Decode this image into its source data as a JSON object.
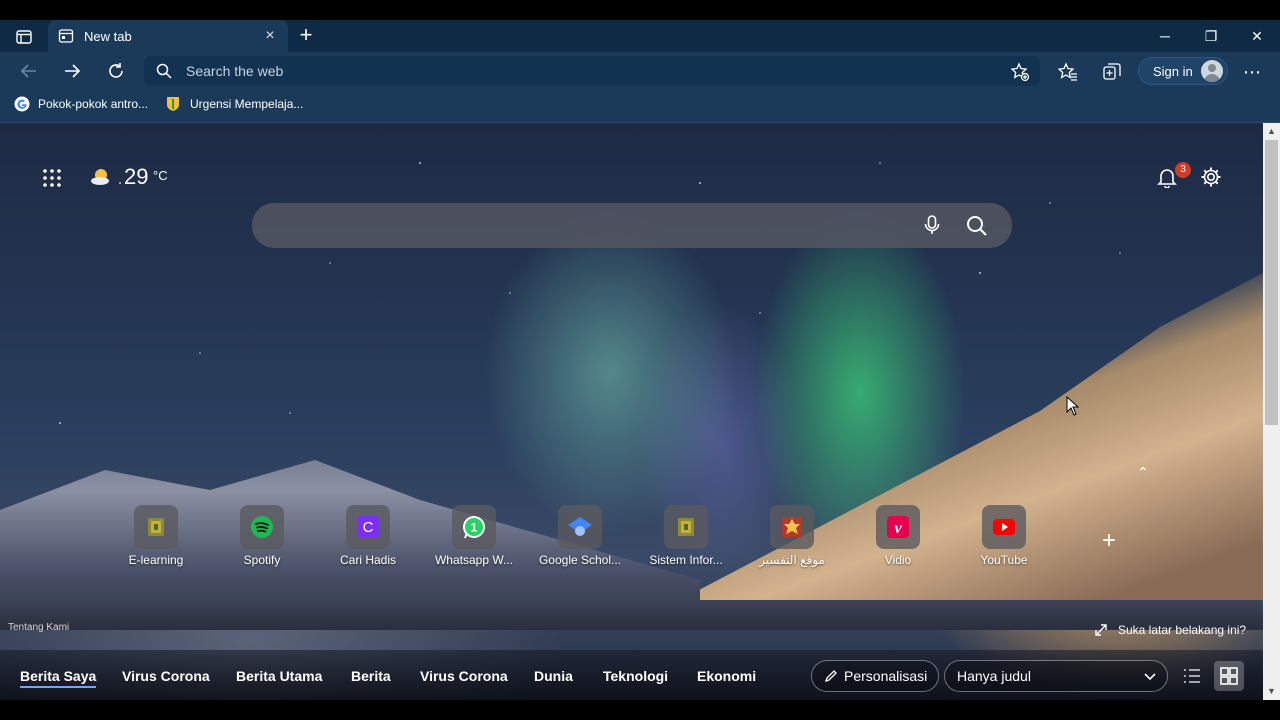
{
  "browser": {
    "tab": {
      "title": "New tab",
      "close": "×"
    },
    "new_tab": "+",
    "window_controls": {
      "minimize": "─",
      "restore": "❐",
      "close": "✕"
    },
    "omnibox": {
      "placeholder": "Search the web"
    },
    "signin": "Sign in",
    "menu": "⋯",
    "bookmarks": [
      {
        "label": "Pokok-pokok antro...",
        "icon": "google-icon"
      },
      {
        "label": "Urgensi Mempelaja...",
        "icon": "shield-icon"
      }
    ]
  },
  "newtab": {
    "weather": {
      "temp": "29",
      "unit": "°C"
    },
    "notifications": {
      "count": "3"
    },
    "quick_links": [
      {
        "label": "E-learning",
        "icon": "elearning-icon",
        "color": "#6b7b2c"
      },
      {
        "label": "Spotify",
        "icon": "spotify-icon",
        "color": "#1db954"
      },
      {
        "label": "Cari Hadis",
        "icon": "c-icon",
        "color": "#7b2ff7"
      },
      {
        "label": "Whatsapp W...",
        "icon": "whatsapp-icon",
        "color": "#25d366"
      },
      {
        "label": "Google Schol...",
        "icon": "google-scholar-icon",
        "color": "#4285f4"
      },
      {
        "label": "Sistem Infor...",
        "icon": "sistem-informasi-icon",
        "color": "#6b7b2c"
      },
      {
        "label": "موقع التفسير",
        "icon": "tafsir-icon",
        "color": "#b03a2e"
      },
      {
        "label": "Vidio",
        "icon": "vidio-icon",
        "color": "#e5004f"
      },
      {
        "label": "YouTube",
        "icon": "youtube-icon",
        "color": "#ff0000"
      }
    ],
    "add_link": "+",
    "collapse": "⌃",
    "about": "Tentang Kami",
    "like_background": "Suka latar belakang ini?"
  },
  "news": {
    "tabs": [
      "Berita Saya",
      "Virus Corona",
      "Berita Utama",
      "Berita",
      "Virus Corona",
      "Dunia",
      "Teknologi",
      "Ekonomi"
    ],
    "personalize": "Personalisasi",
    "view": "Hanya judul"
  },
  "scrollbar": {
    "up": "▲",
    "down": "▼"
  }
}
